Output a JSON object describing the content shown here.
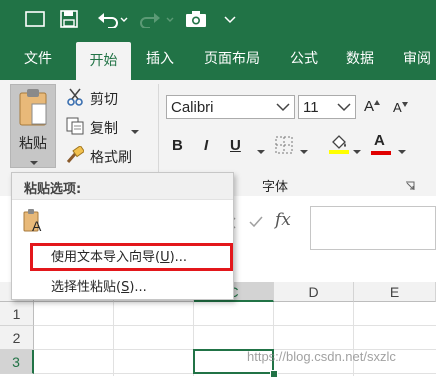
{
  "quick_access": {
    "icons": [
      "window-icon",
      "save-icon",
      "undo-icon",
      "redo-icon",
      "camera-icon",
      "customize-icon"
    ]
  },
  "tabs": [
    {
      "label": "文件",
      "active": false
    },
    {
      "label": "开始",
      "active": true
    },
    {
      "label": "插入",
      "active": false
    },
    {
      "label": "页面布局",
      "active": false
    },
    {
      "label": "公式",
      "active": false
    },
    {
      "label": "数据",
      "active": false
    },
    {
      "label": "审阅",
      "active": false
    }
  ],
  "clipboard": {
    "paste_label": "粘贴",
    "cut_label": "剪切",
    "copy_label": "复制",
    "format_painter_label": "格式刷"
  },
  "font": {
    "name": "Calibri",
    "size": "11",
    "group_label": "字体",
    "bold": "B",
    "italic": "I",
    "underline": "U",
    "increase_size": "A",
    "decrease_size": "A",
    "font_color_letter": "A",
    "highlight_color": "#ffff00",
    "font_color": "#e00000"
  },
  "formula_bar": {
    "fx_label": "fx"
  },
  "paste_menu": {
    "header": "粘贴选项:",
    "items": [
      {
        "text": "使用文本导入向导(",
        "key": "U",
        "suffix": ")...",
        "highlighted": true
      },
      {
        "text": "选择性粘贴(",
        "key": "S",
        "suffix": ")..."
      }
    ]
  },
  "grid": {
    "columns": [
      "C",
      "D",
      "E"
    ],
    "rows": [
      "1",
      "2",
      "3"
    ],
    "selected_column": "C",
    "selected_row": "3"
  },
  "watermark": "https://blog.csdn.net/sxzlc",
  "colors": {
    "accent": "#217346",
    "ribbon_bg": "#f3f3f3",
    "highlight_box": "#e3171b"
  }
}
